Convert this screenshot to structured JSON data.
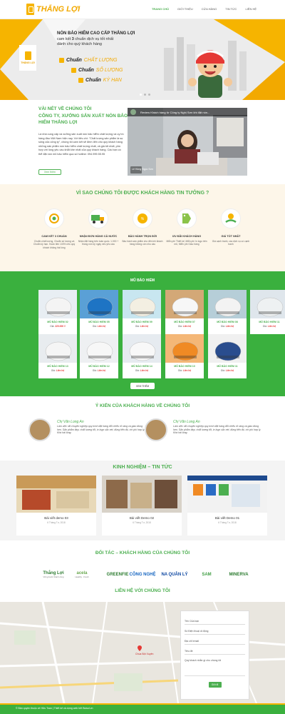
{
  "brand": {
    "name": "THẮNG LỢI",
    "logo_sub": "THẮNG LỢI"
  },
  "nav": [
    "TRANG CHỦ",
    "GIỚI THIỆU",
    "CỬA HÀNG",
    "TIN TỨC",
    "LIÊN HỆ"
  ],
  "hero": {
    "title": "NÓN BẢO HIỂM CAO CẤP THẮNG LỢI",
    "sub_pre": "cam kết",
    "sub_num": "3",
    "sub_post": "chuẩn dịch vụ tốt nhất",
    "sub2": "dành cho quý khách hàng",
    "items": [
      {
        "word": "Chuẩn",
        "hl": "CHẤT LƯỢNG"
      },
      {
        "word": "Chuẩn",
        "hl": "SỐ LƯỢNG"
      },
      {
        "word": "Chuẩn",
        "hl": "KỲ HẠN"
      }
    ]
  },
  "about": {
    "title": "VÀI NÉT VỀ CHÚNG TÔI",
    "sub": "CÔNG TY, XƯỞNG SẢN XUẤT NÓN BẢO HIỂM THẮNG LỢI",
    "body": "Là nhà cung cấp và xưởng sản xuất nón bảo hiểm chất lượng và uy tín hàng đầu Việt Nam hiện nay. Với tiêu chí: \"Chất lượng sản phẩm là sự sống của công ty\", chúng tôi cam kết sẽ đem đến cho quý khách hàng những sản phẩm nón bảo hiểm chất lượng nhất, và giá tốt nhất, phù hợp với lòng yêu cầu khắt khe nhất của quý khách hàng. Các bạn có thể đặt nón mũ bảo hiểm qua số hotline: 094.999.55.95",
    "more": "Xem thêm",
    "video_title": "Review Khách hàng từ Công ty Nghị Sơn khi đặt nón...",
    "video_channel": "Lê Hồng Ngọc Sơn"
  },
  "why": {
    "title": "VÌ SAO CHÚNG TÔI ĐƯỢC KHÁCH HÀNG TIN TƯỞNG ?",
    "items": [
      {
        "icon": "gear-check-icon",
        "h": "CAM KẾT 3 CHUẨN",
        "d": "Chuẩn chất lượng, Chuẩn số lượng và Chuẩn kỳ hạn. Hoàn tiền 100% nếu quý khách không hài lòng"
      },
      {
        "icon": "delivery-truck-icon",
        "h": "NHẬN ĐƠN HÀNG CẢ NƯỚC",
        "d": "Nhận đặt hàng trên toàn quốc. 1.000 + thùng nón ký ngày nếu yêu cầu"
      },
      {
        "icon": "percent-badge-icon",
        "h": "BẢO HÀNH TRỌN ĐỜI",
        "d": "Bảo hành sản phẩm cho đến khi khách hàng không còn nhu cầu"
      },
      {
        "icon": "free-tag-icon",
        "h": "ƯU ĐÃI KHÁCH HÀNG",
        "d": "Miễn phí Thiết kế, Miễn phí In logo trên mũ, Miễn phí Giao hàng"
      },
      {
        "icon": "handshake-dollar-icon",
        "h": "GIÁ TỐT NHẤT",
        "d": "Giá cạnh tranh, các dịch vụ có cạnh tranh"
      }
    ]
  },
  "products": {
    "title": "MŨ BẢO HIỂM",
    "more": "XEM THÊM",
    "price_label": "Giá:",
    "items": [
      {
        "name": "MŨ BẢO HIỂM 02",
        "price": "220.000 ₫",
        "color": "#e8eef3",
        "helmet": "#f4f4f4"
      },
      {
        "name": "MŨ BẢO HIỂM 05",
        "price": "Liên hệ",
        "color": "#5aa0d6",
        "helmet": "#1e74c4"
      },
      {
        "name": "MŨ BẢO HIỂM 09",
        "price": "Liên hệ",
        "color": "#c8e6f0",
        "helmet": "#f3efe2"
      },
      {
        "name": "MŨ BẢO HIỂM 07",
        "price": "Liên hệ",
        "color": "#d3a877",
        "helmet": "#f7f7f7"
      },
      {
        "name": "MŨ BẢO HIỂM 08",
        "price": "Liên hệ",
        "color": "#b6ced8",
        "helmet": "#f3f3f3"
      },
      {
        "name": "MŨ BẢO HIỂM 11",
        "price": "Liên hệ",
        "color": "#dfe6ec",
        "helmet": "#eef1f2"
      },
      {
        "name": "MŨ BẢO HIỂM 13",
        "price": "Liên hệ",
        "color": "#e8ecef",
        "helmet": "#f5f5f5"
      },
      {
        "name": "MŨ BẢO HIỂM 12",
        "price": "Liên hệ",
        "color": "#eef0f2",
        "helmet": "#f7f7f7"
      },
      {
        "name": "MŨ BẢO HIỂM 14",
        "price": "Liên hệ",
        "color": "#e6ebf0",
        "helmet": "#f8f8f8"
      },
      {
        "name": "MŨ BẢO HIỂM 10",
        "price": "Liên hệ",
        "color": "#f4b777",
        "helmet": "#f08a24"
      },
      {
        "name": "MŨ BẢO HIỂM 11",
        "price": "Liên hệ",
        "color": "#f0f0f0",
        "helmet": "#2a4d8e"
      }
    ]
  },
  "testimonials": {
    "title": "Ý KIẾN CỦA KHÁCH HÀNG VỀ CHÚNG TÔI",
    "items": [
      {
        "name": "Chị Văn Long An",
        "text": "Làm việc rất chuyên nghiệp quy trình đặt hàng đối chiếu rõ ràng và giao đúng hẹn. Sản phẩm đẹp, chất lượng tốt, in logo sắc nét, đúng tiến độ, chi phí hợp lý. Khá hài lòng."
      },
      {
        "name": "Chị Văn Long An",
        "text": "Làm việc rất chuyên nghiệp quy trình đặt hàng đối chiếu rõ ràng và giao đúng hẹn. Sản phẩm đẹp, chất lượng tốt, in logo sắc nét, đúng tiến độ, chi phí hợp lý. Khá hài lòng."
      }
    ]
  },
  "news": {
    "title": "KINH NGHIỆM – TIN TỨC",
    "items": [
      {
        "title": "Bài viết demo 03",
        "date": "6 Tháng Tư, 2018"
      },
      {
        "title": "Bài viết Demo 02",
        "date": "6 Tháng Tư, 2018"
      },
      {
        "title": "Bài viết Demo 01",
        "date": "6 Tháng Tư, 2018"
      }
    ]
  },
  "partners": {
    "title": "ĐỐI TÁC – KHÁCH HÀNG CỦA CHÚNG TÔI",
    "items": [
      {
        "name": "Thắng Lợi",
        "sub": "Vững bước thành công",
        "color": "#2e7d32"
      },
      {
        "name": "acela",
        "sub": "Healthy · Fresh",
        "color": "#6aa84f"
      },
      {
        "name": "GREENFIE",
        "sub": "",
        "color": "#2e7d32"
      },
      {
        "name": "CÔNG NGHỆ",
        "sub": "",
        "color": "#1565c0"
      },
      {
        "name": "NA QUÂN LÝ",
        "sub": "",
        "color": "#0d47a1"
      },
      {
        "name": "SAM",
        "sub": "",
        "color": "#43a047"
      },
      {
        "name": "MINERVA",
        "sub": "",
        "color": "#2e7d32"
      }
    ]
  },
  "contact": {
    "title": "LIÊN HỆ VỚI CHÚNG TÔI",
    "fields": [
      "Tên Của bạn",
      "Số Điện thoại di động",
      "Địa chỉ email",
      "Tiêu đề",
      "Quý khách nhắn gì cho chúng tôi"
    ],
    "send": "Gửi đi",
    "map_label": "Chùa Bột Xuyên"
  },
  "footer": "© Bản quyền thuộc về Hữu Toan | Thiết kế và dựng web bởi Buisol.vn"
}
